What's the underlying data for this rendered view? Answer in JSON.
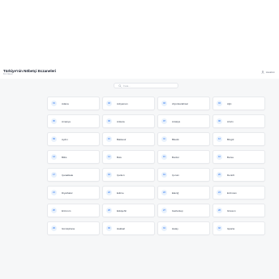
{
  "header": {
    "title": "Türkiye'nin Nöbetçi Eczaneleri",
    "subtitle": "81 il listesi",
    "user_link": "Hesabım",
    "colors": {
      "accent": "#3b82f6",
      "badge_bg": "#e8f1fc",
      "page_bg": "#f6f7f8"
    }
  },
  "search": {
    "placeholder": "İl ara..."
  },
  "cities": [
    {
      "code": "01",
      "name": "Adana"
    },
    {
      "code": "02",
      "name": "Adıyaman"
    },
    {
      "code": "03",
      "name": "Afyonkarahisar"
    },
    {
      "code": "04",
      "name": "Ağrı"
    },
    {
      "code": "05",
      "name": "Amasya"
    },
    {
      "code": "06",
      "name": "Ankara"
    },
    {
      "code": "07",
      "name": "Antalya"
    },
    {
      "code": "08",
      "name": "Artvin"
    },
    {
      "code": "09",
      "name": "Aydın"
    },
    {
      "code": "10",
      "name": "Balıkesir"
    },
    {
      "code": "11",
      "name": "Bilecik"
    },
    {
      "code": "12",
      "name": "Bingöl"
    },
    {
      "code": "13",
      "name": "Bitlis"
    },
    {
      "code": "14",
      "name": "Bolu"
    },
    {
      "code": "15",
      "name": "Burdur"
    },
    {
      "code": "16",
      "name": "Bursa"
    },
    {
      "code": "17",
      "name": "Çanakkale"
    },
    {
      "code": "18",
      "name": "Çankırı"
    },
    {
      "code": "19",
      "name": "Çorum"
    },
    {
      "code": "20",
      "name": "Denizli"
    },
    {
      "code": "21",
      "name": "Diyarbakır"
    },
    {
      "code": "22",
      "name": "Edirne"
    },
    {
      "code": "23",
      "name": "Elazığ"
    },
    {
      "code": "24",
      "name": "Erzincan"
    },
    {
      "code": "25",
      "name": "Erzurum"
    },
    {
      "code": "26",
      "name": "Eskişehir"
    },
    {
      "code": "27",
      "name": "Gaziantep"
    },
    {
      "code": "28",
      "name": "Giresun"
    },
    {
      "code": "29",
      "name": "Gümüşhane"
    },
    {
      "code": "30",
      "name": "Hakkari"
    },
    {
      "code": "31",
      "name": "Hatay"
    },
    {
      "code": "32",
      "name": "Isparta"
    }
  ]
}
